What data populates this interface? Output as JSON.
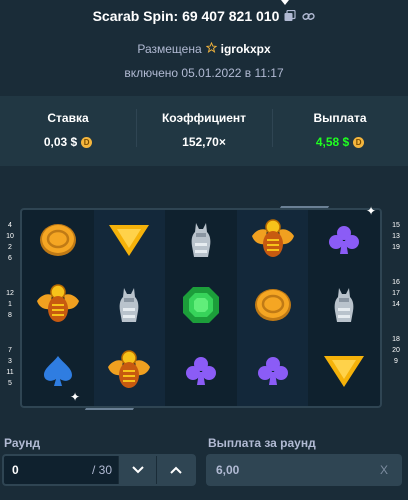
{
  "header": {
    "title": "Scarab Spin: 69 407 821 010"
  },
  "meta": {
    "placed_label": "Размещена",
    "username": "igrokxpx",
    "enabled_text": "включено 05.01.2022 в 11:17"
  },
  "stats": {
    "bet_label": "Ставка",
    "bet_value": "0,03 $",
    "multiplier_label": "Коэффициент",
    "multiplier_value": "152,70×",
    "payout_label": "Выплата",
    "payout_value": "4,58 $",
    "payout_color": "#1fff20",
    "coin_glyph": "D"
  },
  "paylines": {
    "left": [
      "4",
      "10",
      "2",
      "6",
      "12",
      "1",
      "8",
      "7",
      "3",
      "11",
      "5"
    ],
    "right": [
      "15",
      "13",
      "19",
      "16",
      "17",
      "14",
      "18",
      "20",
      "9"
    ]
  },
  "reels": [
    [
      "coin",
      "triangle",
      "cat",
      "scarab",
      "club"
    ],
    [
      "scarab",
      "cat",
      "emerald",
      "coin",
      "cat"
    ],
    [
      "spade",
      "scarab",
      "club",
      "club",
      "triangle"
    ]
  ],
  "form": {
    "round_label": "Раунд",
    "round_value": "0",
    "round_total": "/ 30",
    "round_payout_label": "Выплата за раунд",
    "round_payout_value": "6,00",
    "clear_glyph": "X"
  }
}
